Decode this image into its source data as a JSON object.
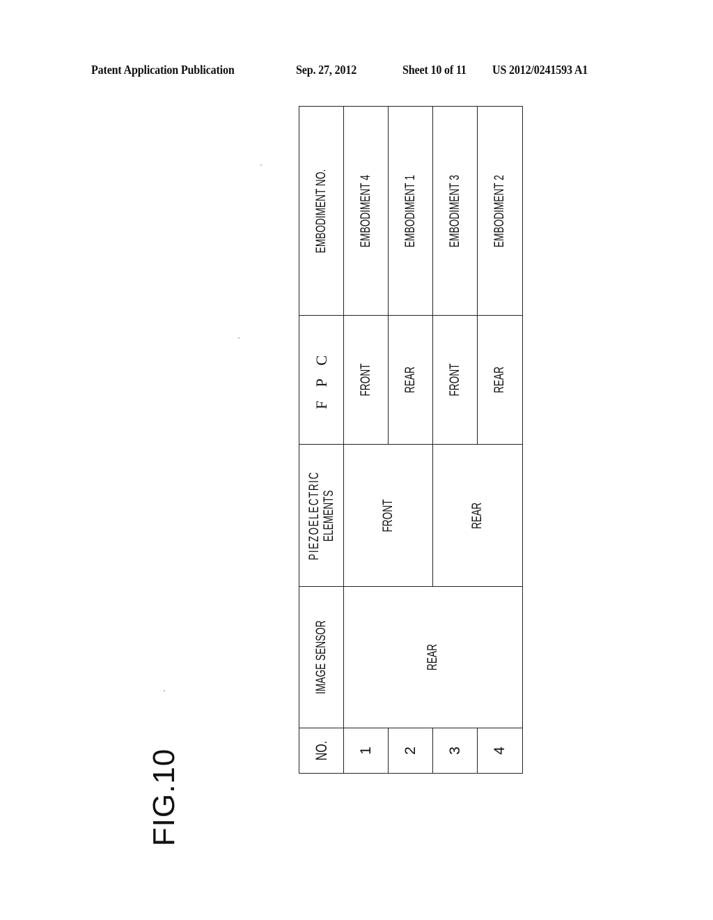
{
  "header": {
    "publication": "Patent Application Publication",
    "date": "Sep. 27, 2012",
    "sheet": "Sheet 10 of 11",
    "number": "US 2012/0241593 A1"
  },
  "figure": {
    "label": "FIG.10"
  },
  "table": {
    "columns": {
      "no": "NO.",
      "image_sensor": "IMAGE SENSOR",
      "piezo_line1": "PIEZOELECTRIC",
      "piezo_line2": "ELEMENTS",
      "fpc": "F P C",
      "embodiment": "EMBODIMENT NO."
    },
    "rows": [
      {
        "no": "1",
        "image_sensor": "REAR",
        "piezo": "FRONT",
        "fpc": "FRONT",
        "embodiment": "EMBODIMENT 4"
      },
      {
        "no": "2",
        "image_sensor": "REAR",
        "piezo": "FRONT",
        "fpc": "REAR",
        "embodiment": "EMBODIMENT 1"
      },
      {
        "no": "3",
        "image_sensor": "REAR",
        "piezo": "REAR",
        "fpc": "FRONT",
        "embodiment": "EMBODIMENT 3"
      },
      {
        "no": "4",
        "image_sensor": "REAR",
        "piezo": "REAR",
        "fpc": "REAR",
        "embodiment": "EMBODIMENT 2"
      }
    ],
    "merged": {
      "image_sensor_all": "REAR",
      "piezo_rows_1_2": "FRONT",
      "piezo_rows_3_4": "REAR"
    }
  }
}
